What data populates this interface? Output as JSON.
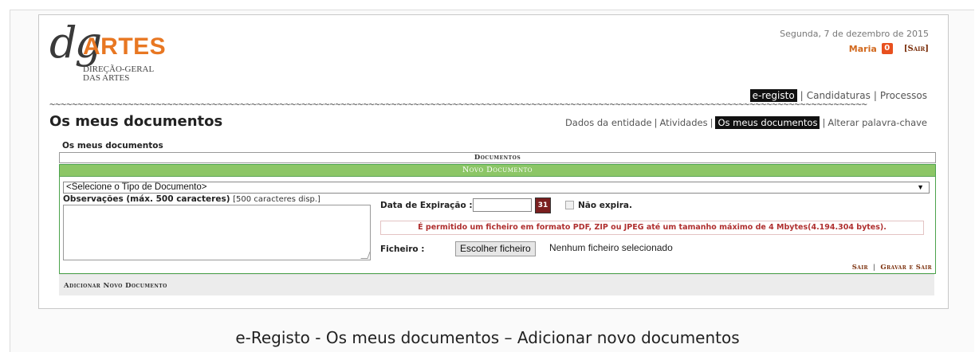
{
  "header": {
    "logo": {
      "dg": "dg",
      "artes": "ARTES",
      "sub_line1": "DIREÇÃO-GERAL",
      "sub_line2": "DAS ARTES"
    },
    "date": "Segunda, 7 de dezembro de 2015",
    "user_name": "Maria",
    "user_badge": "0",
    "logout_label": "[Sair]"
  },
  "main_nav": {
    "items": [
      {
        "label": "e-registo",
        "active": true
      },
      {
        "label": "Candidaturas",
        "active": false
      },
      {
        "label": "Processos",
        "active": false
      }
    ]
  },
  "page": {
    "title": "Os meus documentos",
    "rule": "~~~~~~~~~~~~~~~~~~~~~~~~~~~~~~~~~~~~~~~~~~~~~~~~~~~~~~~~~~~~~~~~~~~~~~~~~~~~~~~~~~~~~~~~~~~~~~~~~~~~~~~~~~~~~~~~~~~~~~~~~~~~~~~~~~~~~~~~~~~~~~~~~~"
  },
  "sub_nav": {
    "items": [
      {
        "label": "Dados da entidade",
        "active": false
      },
      {
        "label": "Atividades",
        "active": false
      },
      {
        "label": "Os meus documentos",
        "active": true
      },
      {
        "label": "Alterar palavra-chave",
        "active": false
      }
    ]
  },
  "section": {
    "label": "Os meus documentos",
    "documents_bar": "Documentos"
  },
  "form": {
    "header": "Novo Documento",
    "doc_type_selected": "<Selecione o Tipo de Documento>",
    "obs_label": "Observações (máx. 500 caracteres)",
    "obs_count": "[500 caracteres disp.]",
    "expiry_label": "Data de Expiração :",
    "expiry_value": "",
    "calendar_glyph": "31",
    "no_expiry_label": "Não expira.",
    "notice": "É permitido um ficheiro em formato PDF, ZIP ou JPEG até um tamanho máximo de 4 Mbytes(4.194.304 bytes).",
    "file_label": "Ficheiro :",
    "file_button": "Escolher ficheiro",
    "file_status": "Nenhum ficheiro selecionado",
    "action_exit": "Sair",
    "action_save_exit": "Gravar e Sair",
    "add_new": "Adicionar Novo Documento"
  },
  "caption": "e-Registo - Os meus documentos – Adicionar novo documentos",
  "colors": {
    "brand_orange": "#e87722",
    "green_header": "#8cc666",
    "notice_red": "#b03030"
  }
}
